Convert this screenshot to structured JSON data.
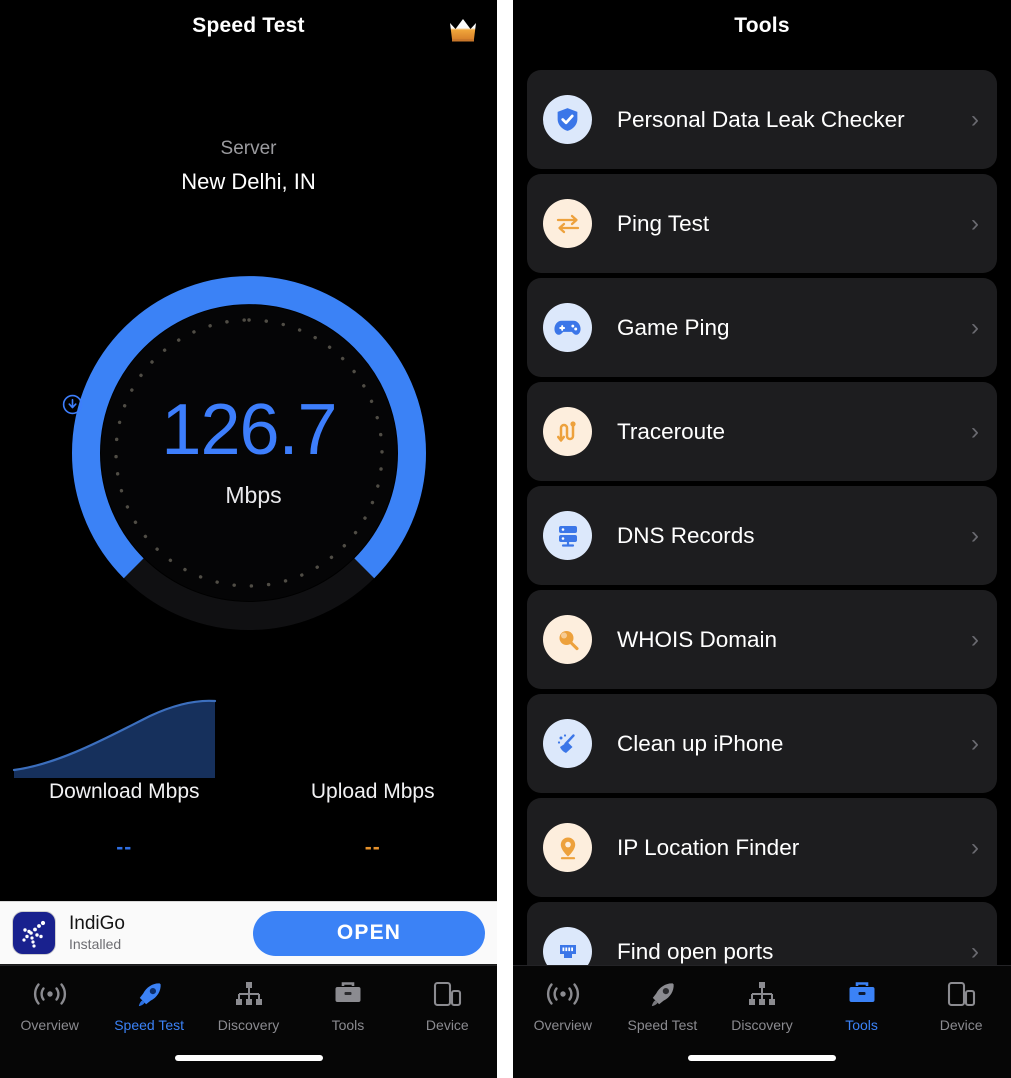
{
  "left_screen": {
    "nav": {
      "title": "Speed Test",
      "premium_icon": "crown-icon"
    },
    "server": {
      "label": "Server",
      "value": "New Delhi, IN"
    },
    "gauge": {
      "value": "126.7",
      "unit": "Mbps",
      "direction_icon": "download-circle-icon",
      "arc_color": "#3b82f6",
      "track_color": "#141414",
      "percent": 72
    },
    "results": {
      "download": {
        "label": "Download Mbps",
        "value": "--",
        "color": "#2f6fe4"
      },
      "upload": {
        "label": "Upload Mbps",
        "value": "--",
        "color": "#e7922c"
      }
    },
    "ad": {
      "app_name": "IndiGo",
      "status": "Installed",
      "cta_label": "OPEN",
      "icon": "indigo-app-icon",
      "cta_color": "#3b82f6"
    }
  },
  "right_screen": {
    "nav": {
      "title": "Tools"
    },
    "tools": [
      {
        "label": "Personal Data Leak Checker",
        "icon": "shield-check-icon",
        "tone": "blue"
      },
      {
        "label": "Ping Test",
        "icon": "arrows-exchange-icon",
        "tone": "orange"
      },
      {
        "label": "Game Ping",
        "icon": "gamepad-icon",
        "tone": "blue"
      },
      {
        "label": "Traceroute",
        "icon": "route-zigzag-icon",
        "tone": "orange"
      },
      {
        "label": "DNS Records",
        "icon": "server-rack-icon",
        "tone": "blue"
      },
      {
        "label": "WHOIS Domain",
        "icon": "magnifier-icon",
        "tone": "orange"
      },
      {
        "label": "Clean up iPhone",
        "icon": "broom-icon",
        "tone": "blue"
      },
      {
        "label": "IP Location Finder",
        "icon": "map-pin-icon",
        "tone": "orange"
      },
      {
        "label": "Find open ports",
        "icon": "ethernet-port-icon",
        "tone": "blue"
      }
    ],
    "chevron": "›"
  },
  "tabbar": {
    "items": [
      {
        "label": "Overview",
        "icon": "signal-waves-icon"
      },
      {
        "label": "Speed Test",
        "icon": "rocket-icon"
      },
      {
        "label": "Discovery",
        "icon": "network-tree-icon"
      },
      {
        "label": "Tools",
        "icon": "toolbox-icon"
      },
      {
        "label": "Device",
        "icon": "devices-icon"
      }
    ],
    "left_active": "Speed Test",
    "right_active": "Tools",
    "active_color": "#3b82f6",
    "inactive_color": "#8b8b90"
  },
  "chart_data": {
    "type": "area",
    "title": "Download Mbps",
    "xlabel": "",
    "ylabel": "Mbps",
    "series": [
      {
        "name": "Download",
        "values": [
          0,
          18,
          42,
          68,
          88,
          100,
          106,
          108,
          107,
          105
        ]
      }
    ],
    "x": [
      0,
      1,
      2,
      3,
      4,
      5,
      6,
      7,
      8,
      9
    ],
    "ylim": [
      0,
      130
    ],
    "grid": false,
    "legend": "none",
    "line_color": "#3c6fbe",
    "fill_color": "#16305c"
  }
}
